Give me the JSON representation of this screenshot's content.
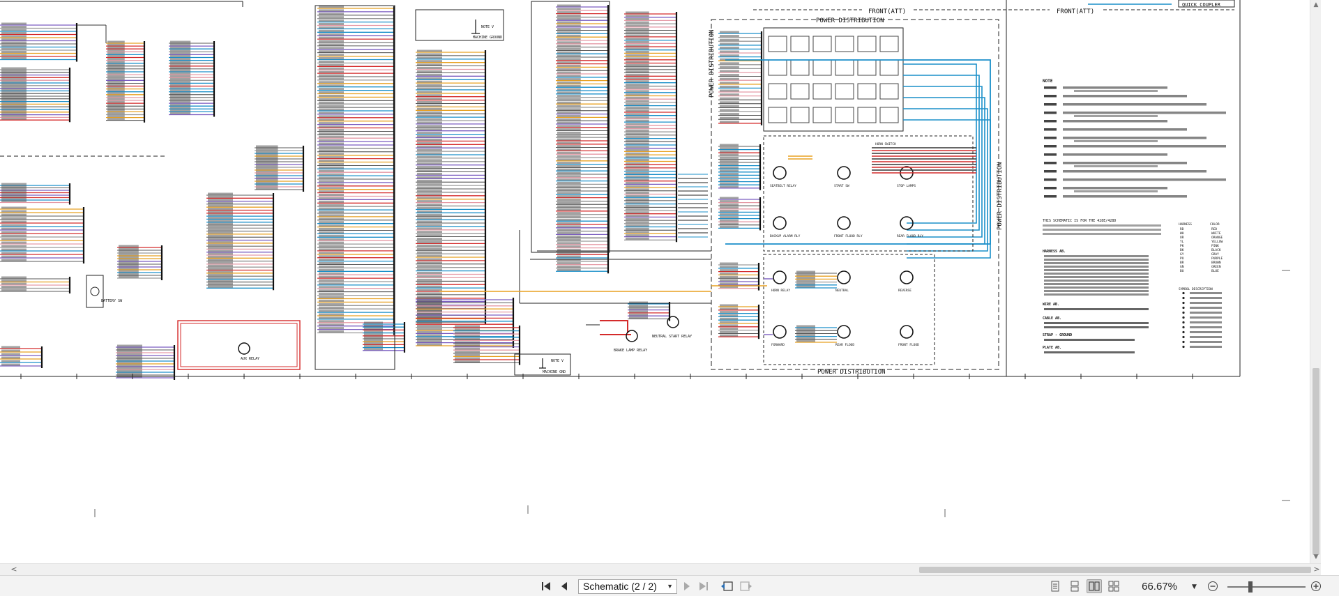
{
  "schematic": {
    "labels": {
      "front_att_left": "FRONT(ATT)",
      "front_att_right": "FRONT(ATT)",
      "quick_coupler": "QUICK COUPLER",
      "power_distribution_top": "POWER DISTRIBUTION",
      "power_distribution_bottom": "POWER DISTRIBUTION",
      "power_distribution_left": "POWER DISTRIBUTION",
      "power_distribution_right": "POWER DISTRIBUTION",
      "note_machine_ground_top": "NOTE V",
      "machine_ground_top": "MACHINE GROUND",
      "note_machine_ground_bottom": "NOTE V",
      "machine_ground_bottom": "MACHINE GND",
      "brake_lamp_relay": "BRAKE LAMP RELAY",
      "neutral_start_relay": "NEUTRAL START RELAY",
      "battery_sw": "BATTERY SW",
      "aux_relay": "AUX RELAY",
      "seatbelt_relay": "SEATBELT RELAY",
      "backup_alarm_relay": "BACKUP ALARM RLY",
      "front_flood_relay": "FRONT FLOOD RLY",
      "rear_flood_relay": "REAR FLOOD RLY",
      "horn_relay": "HORN RELAY",
      "neutral_relay": "NEUTRAL",
      "reverse_relay": "REVERSE",
      "forward_relay": "FORWARD",
      "notes_title": "NOTE",
      "schematic_note": "THIS SCHEMATIC IS FOR THE 428E/428D",
      "harness_ab": "HARNESS AB.",
      "wire_ab": "WIRE AB.",
      "cable_ab": "CABLE AB.",
      "strap_ground": "STRAP - GROUND",
      "plate_ab": "PLATE AB.",
      "harness_col": "HARNESS",
      "color_col": "COLOR",
      "symbol_desc_col": "SYMBOL   DESCRIPTION",
      "start_sw": "START SW",
      "stop_lamps": "STOP LAMPS",
      "horn_switch": "HORN SWITCH",
      "rear_flood": "REAR FLOOD",
      "front_flood": "FRONT FLOOD"
    },
    "color_legend": [
      [
        "RD",
        "RED"
      ],
      [
        "WH",
        "WHITE"
      ],
      [
        "OR",
        "ORANGE"
      ],
      [
        "YL",
        "YELLOW"
      ],
      [
        "PK",
        "PINK"
      ],
      [
        "BK",
        "BLACK"
      ],
      [
        "GY",
        "GRAY"
      ],
      [
        "PU",
        "PURPLE"
      ],
      [
        "BR",
        "BROWN"
      ],
      [
        "GN",
        "GREEN"
      ],
      [
        "BU",
        "BLUE"
      ]
    ]
  },
  "toolbar": {
    "page_label": "Schematic (2 / 2)",
    "zoom": "66.67%"
  },
  "colors": {
    "wire_blue": "#1a8fc9",
    "wire_red": "#d42b2b",
    "wire_orange": "#e8a020",
    "wire_purple": "#7a5cc0",
    "wire_black": "#222222",
    "wire_gray": "#9a9a9a",
    "wire_pink": "#e59aa6"
  }
}
